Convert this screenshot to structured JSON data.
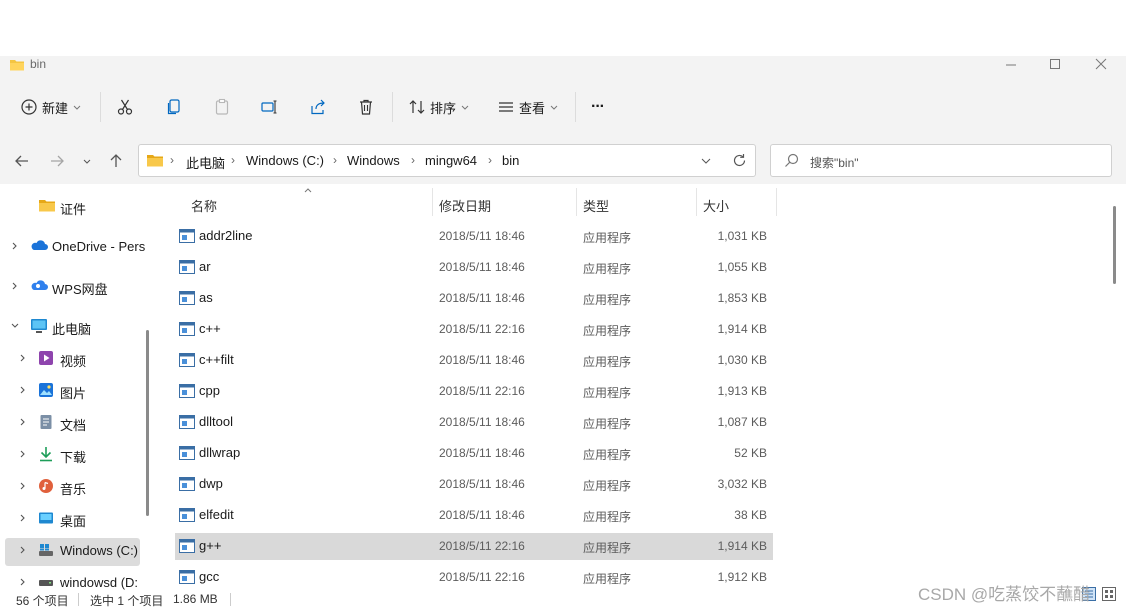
{
  "window": {
    "title": "bin"
  },
  "toolbar": {
    "new_label": "新建",
    "sort_label": "排序",
    "view_label": "查看",
    "more_label": "···"
  },
  "address": {
    "crumbs": [
      "此电脑",
      "Windows (C:)",
      "Windows",
      "mingw64",
      "bin"
    ],
    "sep": "›"
  },
  "search": {
    "placeholder": "搜索\"bin\""
  },
  "sidebar": {
    "items": [
      {
        "label": "证件",
        "icon": "folder-icon"
      },
      {
        "label": "OneDrive - Pers",
        "icon": "onedrive-icon"
      },
      {
        "label": "WPS网盘",
        "icon": "wps-cloud-icon"
      },
      {
        "label": "此电脑",
        "icon": "computer-icon"
      },
      {
        "label": "视频",
        "icon": "videos-icon"
      },
      {
        "label": "图片",
        "icon": "pictures-icon"
      },
      {
        "label": "文档",
        "icon": "documents-icon"
      },
      {
        "label": "下载",
        "icon": "downloads-icon"
      },
      {
        "label": "音乐",
        "icon": "music-icon"
      },
      {
        "label": "桌面",
        "icon": "desktop-icon"
      },
      {
        "label": "Windows (C:)",
        "icon": "drive-c-icon"
      },
      {
        "label": "windowsd (D:",
        "icon": "drive-d-icon"
      }
    ]
  },
  "columns": {
    "name": "名称",
    "date": "修改日期",
    "type": "类型",
    "size": "大小"
  },
  "files": [
    {
      "name": "addr2line",
      "date": "2018/5/11 18:46",
      "type": "应用程序",
      "size": "1,031 KB"
    },
    {
      "name": "ar",
      "date": "2018/5/11 18:46",
      "type": "应用程序",
      "size": "1,055 KB"
    },
    {
      "name": "as",
      "date": "2018/5/11 18:46",
      "type": "应用程序",
      "size": "1,853 KB"
    },
    {
      "name": "c++",
      "date": "2018/5/11 22:16",
      "type": "应用程序",
      "size": "1,914 KB"
    },
    {
      "name": "c++filt",
      "date": "2018/5/11 18:46",
      "type": "应用程序",
      "size": "1,030 KB"
    },
    {
      "name": "cpp",
      "date": "2018/5/11 22:16",
      "type": "应用程序",
      "size": "1,913 KB"
    },
    {
      "name": "dlltool",
      "date": "2018/5/11 18:46",
      "type": "应用程序",
      "size": "1,087 KB"
    },
    {
      "name": "dllwrap",
      "date": "2018/5/11 18:46",
      "type": "应用程序",
      "size": "52 KB"
    },
    {
      "name": "dwp",
      "date": "2018/5/11 18:46",
      "type": "应用程序",
      "size": "3,032 KB"
    },
    {
      "name": "elfedit",
      "date": "2018/5/11 18:46",
      "type": "应用程序",
      "size": "38 KB"
    },
    {
      "name": "g++",
      "date": "2018/5/11 22:16",
      "type": "应用程序",
      "size": "1,914 KB"
    },
    {
      "name": "gcc",
      "date": "2018/5/11 22:16",
      "type": "应用程序",
      "size": "1,912 KB"
    }
  ],
  "status": {
    "count": "56 个项目",
    "selected": "选中 1 个项目",
    "size": "1.86 MB"
  },
  "watermark": "CSDN @吃蒸饺不蘸醋",
  "colors": {
    "folder": "#f4c542",
    "accent": "#0067c0",
    "selected_row": "#d9d9d9"
  }
}
